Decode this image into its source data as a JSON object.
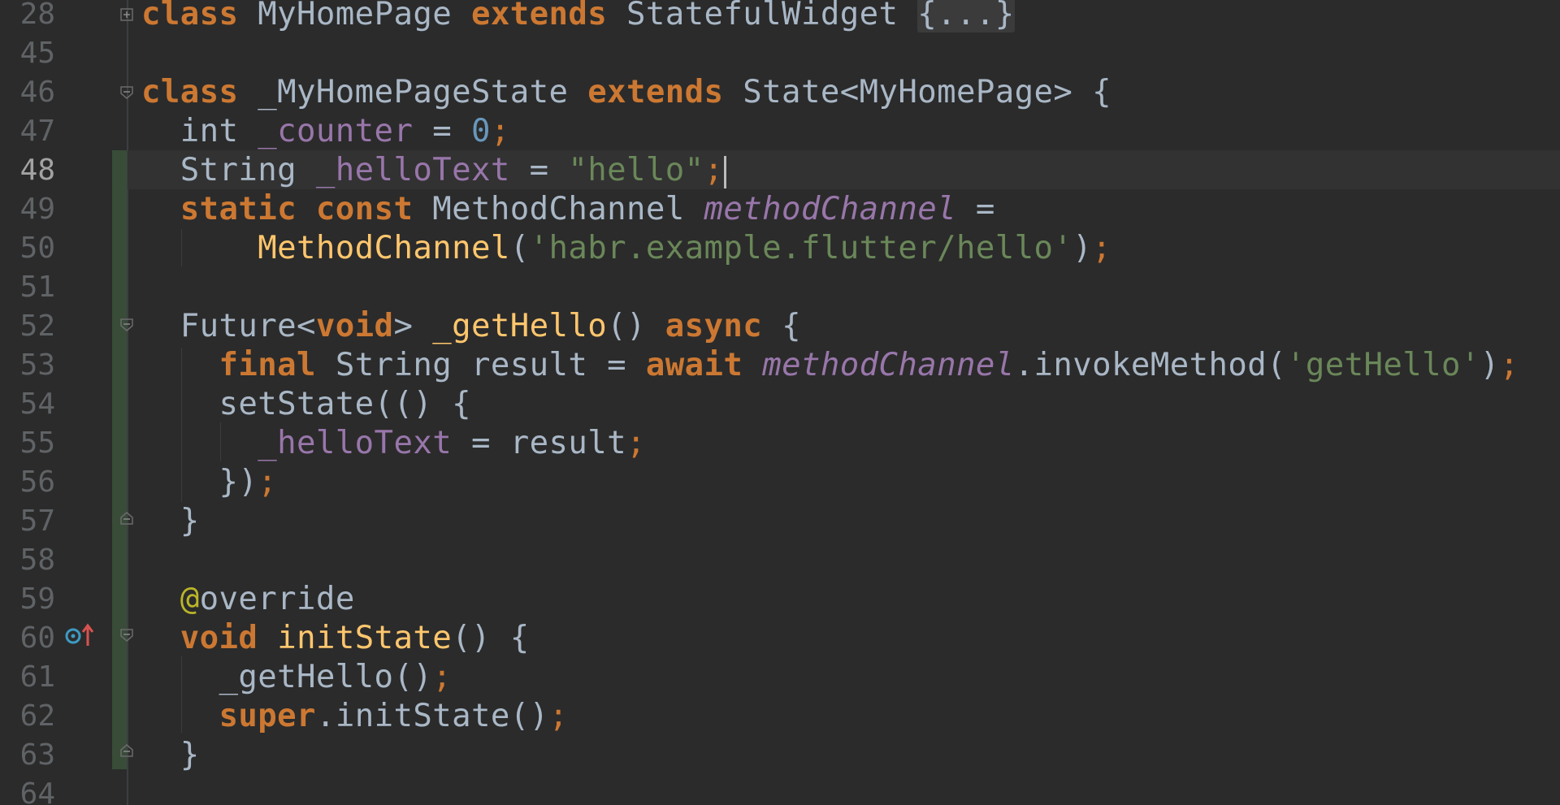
{
  "editor": {
    "language": "dart",
    "current_line": "48",
    "lines": [
      {
        "n": "28",
        "segs": [
          [
            "kw",
            "class"
          ],
          [
            "plain",
            " MyHomePage "
          ],
          [
            "kw",
            "extends"
          ],
          [
            "plain",
            " StatefulWidget "
          ],
          [
            "folded",
            "{...}"
          ]
        ]
      },
      {
        "n": "45",
        "segs": []
      },
      {
        "n": "46",
        "segs": [
          [
            "kw",
            "class"
          ],
          [
            "plain",
            " _MyHomePageState "
          ],
          [
            "kw",
            "extends"
          ],
          [
            "plain",
            " State<MyHomePage> {"
          ]
        ]
      },
      {
        "n": "47",
        "segs": [
          [
            "plain",
            "  int "
          ],
          [
            "fld",
            "_counter"
          ],
          [
            "plain",
            " = "
          ],
          [
            "num",
            "0"
          ],
          [
            "semi",
            ";"
          ]
        ]
      },
      {
        "n": "48",
        "segs": [
          [
            "plain",
            "  String "
          ],
          [
            "fld",
            "_helloText"
          ],
          [
            "plain",
            " = "
          ],
          [
            "str",
            "\"hello\""
          ],
          [
            "semi",
            ";"
          ]
        ]
      },
      {
        "n": "49",
        "segs": [
          [
            "plain",
            "  "
          ],
          [
            "kw",
            "static const"
          ],
          [
            "plain",
            " MethodChannel "
          ],
          [
            "fld-i",
            "methodChannel"
          ],
          [
            "plain",
            " ="
          ]
        ]
      },
      {
        "n": "50",
        "segs": [
          [
            "plain",
            "      "
          ],
          [
            "fn",
            "MethodChannel"
          ],
          [
            "plain",
            "("
          ],
          [
            "str",
            "'habr.example.flutter/hello'"
          ],
          [
            "plain",
            ")"
          ],
          [
            "semi",
            ";"
          ]
        ]
      },
      {
        "n": "51",
        "segs": []
      },
      {
        "n": "52",
        "segs": [
          [
            "plain",
            "  Future<"
          ],
          [
            "kw",
            "void"
          ],
          [
            "plain",
            "> "
          ],
          [
            "fn",
            "_getHello"
          ],
          [
            "plain",
            "() "
          ],
          [
            "kw",
            "async"
          ],
          [
            "plain",
            " {"
          ]
        ]
      },
      {
        "n": "53",
        "segs": [
          [
            "plain",
            "    "
          ],
          [
            "kw",
            "final"
          ],
          [
            "plain",
            " String result = "
          ],
          [
            "kw",
            "await"
          ],
          [
            "plain",
            " "
          ],
          [
            "fld-i",
            "methodChannel"
          ],
          [
            "plain",
            ".invokeMethod("
          ],
          [
            "str",
            "'getHello'"
          ],
          [
            "plain",
            ")"
          ],
          [
            "semi",
            ";"
          ]
        ]
      },
      {
        "n": "54",
        "segs": [
          [
            "plain",
            "    setState(() {"
          ]
        ]
      },
      {
        "n": "55",
        "segs": [
          [
            "plain",
            "      "
          ],
          [
            "fld",
            "_helloText"
          ],
          [
            "plain",
            " = result"
          ],
          [
            "semi",
            ";"
          ]
        ]
      },
      {
        "n": "56",
        "segs": [
          [
            "plain",
            "    })"
          ],
          [
            "semi",
            ";"
          ]
        ]
      },
      {
        "n": "57",
        "segs": [
          [
            "plain",
            "  }"
          ]
        ]
      },
      {
        "n": "58",
        "segs": []
      },
      {
        "n": "59",
        "segs": [
          [
            "plain",
            "  "
          ],
          [
            "ann",
            "@"
          ],
          [
            "plain",
            "override"
          ]
        ]
      },
      {
        "n": "60",
        "segs": [
          [
            "plain",
            "  "
          ],
          [
            "kw",
            "void"
          ],
          [
            "plain",
            " "
          ],
          [
            "fn",
            "initState"
          ],
          [
            "plain",
            "() {"
          ]
        ]
      },
      {
        "n": "61",
        "segs": [
          [
            "plain",
            "    _getHello()"
          ],
          [
            "semi",
            ";"
          ]
        ]
      },
      {
        "n": "62",
        "segs": [
          [
            "plain",
            "    "
          ],
          [
            "kw",
            "super"
          ],
          [
            "plain",
            ".initState()"
          ],
          [
            "semi",
            ";"
          ]
        ]
      },
      {
        "n": "63",
        "segs": [
          [
            "plain",
            "  }"
          ]
        ]
      },
      {
        "n": "64",
        "segs": []
      }
    ]
  },
  "gutter": {
    "override_marker_line": "60",
    "override_marker_icon": "override-method-icon",
    "fold_markers": [
      "28",
      "46",
      "52",
      "57",
      "60",
      "63"
    ]
  },
  "colors": {
    "background": "#2b2b2b",
    "keyword": "#cc7832",
    "field": "#9876aa",
    "string": "#6a8759",
    "number": "#6897bb",
    "function": "#ffc66d",
    "annotation": "#bbb529",
    "plain": "#a9b7c6",
    "line_number": "#606366",
    "vcs_added": "#384c38"
  }
}
